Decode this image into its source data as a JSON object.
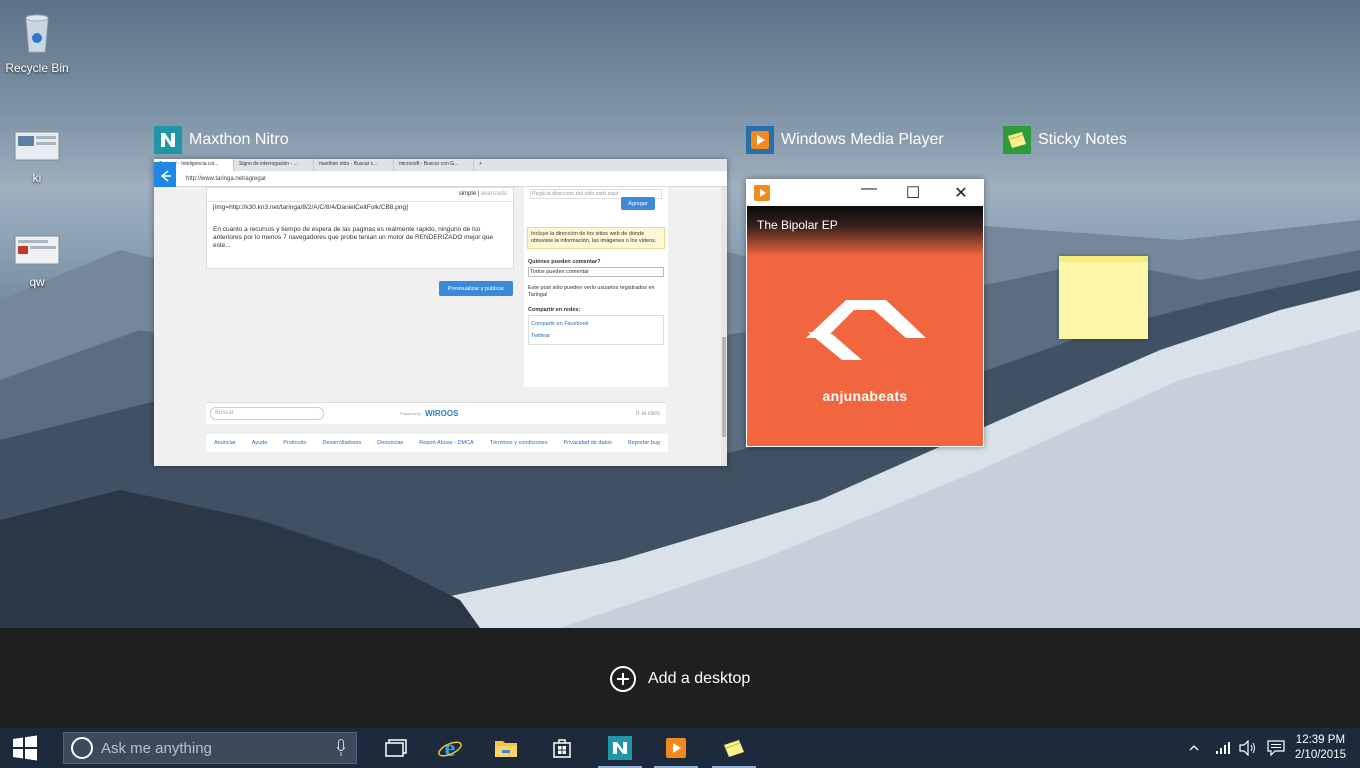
{
  "desktop": {
    "icons": [
      {
        "label": "Recycle Bin"
      },
      {
        "label": "ki"
      },
      {
        "label": "qw"
      }
    ]
  },
  "task_view": {
    "windows": [
      {
        "title": "Maxthon Nitro"
      },
      {
        "title": "Windows Media Player"
      },
      {
        "title": "Sticky Notes"
      }
    ],
    "browser": {
      "tabs": [
        "Taringa! - Inteligencia col...",
        "Signo de interrogación - ...",
        "maxthon nitro - Buscar c...",
        "microsoft - Buscar con G..."
      ],
      "url": "http://www.taringa.net/agregar",
      "editor_mode": "simple",
      "editor_mode_alt": "avanzado",
      "editor_text_1": "[img=http://k30.kn3.net/taringa/8/2/A/C/8/4/DanielCeitFolk/CB8.png]",
      "editor_text_2": "En cuanto a recursos y tiempo de espera de las paginas es realmente rapido, ninguno de lso anteriores por lo menos 7 navegadores que probe tenian un motor de RENDERIZADO mejor que este...",
      "publish_button": "Previsualizar y publicar",
      "source_placeholder": "Pegá la dirección del sitio web aquí",
      "add_button": "Agregar",
      "source_hint": "Incluye la dirección de los sitios web de dónde obtuviste la información, las imágenes o los videos.",
      "who_comment_label": "Quiénes pueden comentar?",
      "who_comment_value": "Todos pueden comentar",
      "registered_only": "Este post sólo pueden verlo usuarios registrados en Taringa!",
      "share_label": "Compartir en redes:",
      "share_facebook": "Compartir en Facebook",
      "share_twitter": "Twittear",
      "search_placeholder": "Buscar",
      "powered_by": "Powered by",
      "powered_brand": "WIROOS",
      "top_link": "Ir al cielo",
      "footer_links": [
        "Anunciar",
        "Ayuda",
        "Protocolo",
        "Desarrolladores",
        "Denuncias",
        "Report Abuse - DMCA",
        "Términos y condiciones",
        "Privacidad de datos",
        "Reportar bug"
      ]
    },
    "media_player": {
      "album": "The Bipolar EP",
      "brand": "anjunabeats",
      "minimize": "—",
      "maximize": "☐",
      "close": "✕"
    },
    "add_desktop_label": "Add a desktop"
  },
  "taskbar": {
    "search_placeholder": "Ask me anything",
    "apps": [
      "task-view",
      "internet-explorer",
      "file-explorer",
      "store",
      "maxthon-nitro",
      "windows-media-player",
      "sticky-notes"
    ],
    "clock_time": "12:39 PM",
    "clock_date": "2/10/2015"
  },
  "colors": {
    "accent": "#1e88e5",
    "taskbar": "#1d2a3c",
    "anjuna_orange": "#f1663e",
    "sticky_yellow": "#fdf6a6"
  }
}
